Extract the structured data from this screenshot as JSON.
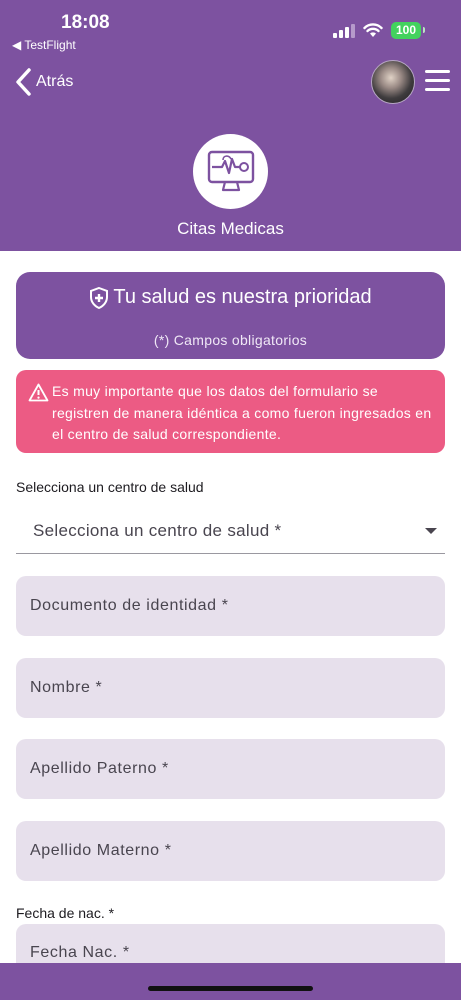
{
  "status_bar": {
    "time": "18:08",
    "back_app": "◀ TestFlight",
    "battery": "100"
  },
  "nav": {
    "back_label": "Atrás"
  },
  "header": {
    "title": "Citas Medicas"
  },
  "priority_card": {
    "title": "Tu salud es nuestra prioridad",
    "note": "(*) Campos obligatorios"
  },
  "warning": {
    "text": "Es muy importante que los datos del formulario se registren de manera idéntica a como fueron ingresados en el centro de salud correspondiente."
  },
  "form": {
    "health_center_label": "Selecciona un centro de salud",
    "health_center_select": "Selecciona un centro de salud *",
    "document_field": "Documento de identidad *",
    "name_field": "Nombre *",
    "paternal_surname_field": "Apellido Paterno *",
    "maternal_surname_field": "Apellido Materno *",
    "birth_date_label": "Fecha de nac. *",
    "birth_date_field": "Fecha Nac. *"
  },
  "colors": {
    "primary": "#7d52a0",
    "warning": "#ec5b84",
    "field_bg": "#e7e0ec"
  },
  "icons": [
    "chevron-left-icon",
    "menu-icon",
    "medical-monitor-icon",
    "shield-plus-icon",
    "warning-triangle-icon",
    "dropdown-caret-icon",
    "signal-icon",
    "wifi-icon"
  ]
}
